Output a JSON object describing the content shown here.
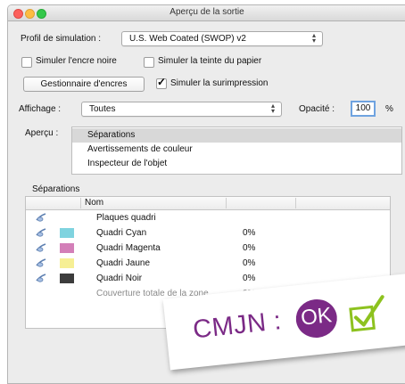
{
  "window": {
    "title": "Aperçu de la sortie"
  },
  "profil": {
    "label": "Profil de simulation :",
    "value": "U.S. Web Coated (SWOP) v2"
  },
  "options": {
    "encre_noire": {
      "label": "Simuler l'encre noire",
      "checked": false
    },
    "teinte_papier": {
      "label": "Simuler la teinte du papier",
      "checked": false
    },
    "surimpression": {
      "label": "Simuler la surimpression",
      "checked": true
    }
  },
  "gestionnaire_label": "Gestionnaire d'encres",
  "affichage": {
    "label": "Affichage :",
    "value": "Toutes"
  },
  "opacite": {
    "label": "Opacité :",
    "value": "100",
    "unit": "%"
  },
  "apercu": {
    "label": "Aperçu :",
    "items": [
      "Séparations",
      "Avertissements de couleur",
      "Inspecteur de l'objet"
    ],
    "selected": 0
  },
  "separations": {
    "section_label": "Séparations",
    "column_nom": "Nom",
    "rows": [
      {
        "name": "Plaques quadri",
        "pct": "",
        "swatch": null,
        "muted": false
      },
      {
        "name": "Quadri Cyan",
        "pct": "0%",
        "swatch": "#7fd3df",
        "muted": false
      },
      {
        "name": "Quadri Magenta",
        "pct": "0%",
        "swatch": "#d37fb8",
        "muted": false
      },
      {
        "name": "Quadri Jaune",
        "pct": "0%",
        "swatch": "#f6ef94",
        "muted": false
      },
      {
        "name": "Quadri Noir",
        "pct": "0%",
        "swatch": "#3c3c3c",
        "muted": false
      },
      {
        "name": "Couverture totale de la zone",
        "pct": "0%",
        "swatch": null,
        "muted": true
      }
    ]
  },
  "badge": {
    "text": "CMJN :",
    "ok": "OK",
    "color": "#7b2a86",
    "check_color": "#8dc21f"
  }
}
